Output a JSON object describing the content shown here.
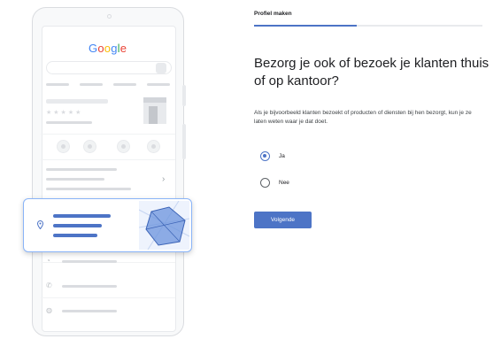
{
  "illustration": {
    "logo_letters": [
      {
        "char": "G",
        "color": "#4285f4"
      },
      {
        "char": "o",
        "color": "#ea4335"
      },
      {
        "char": "o",
        "color": "#fbbc05"
      },
      {
        "char": "g",
        "color": "#4285f4"
      },
      {
        "char": "l",
        "color": "#34a853"
      },
      {
        "char": "e",
        "color": "#ea4335"
      }
    ],
    "stars": "★★★★★",
    "chevron": "›"
  },
  "form": {
    "step_label": "Profiel maken",
    "progress_fraction": 0.45,
    "heading": "Bezorg je ook of bezoek je klanten thuis of op kantoor?",
    "description": "Als je bijvoorbeeld klanten bezoekt of producten of diensten bij hen bezorgt, kun je ze laten weten waar je dat doet.",
    "options": [
      {
        "label": "Ja",
        "selected": true
      },
      {
        "label": "Nee",
        "selected": false
      }
    ],
    "next_button": "Volgende"
  },
  "colors": {
    "accent": "#4d74c6",
    "card_border": "#8ab4f8"
  }
}
